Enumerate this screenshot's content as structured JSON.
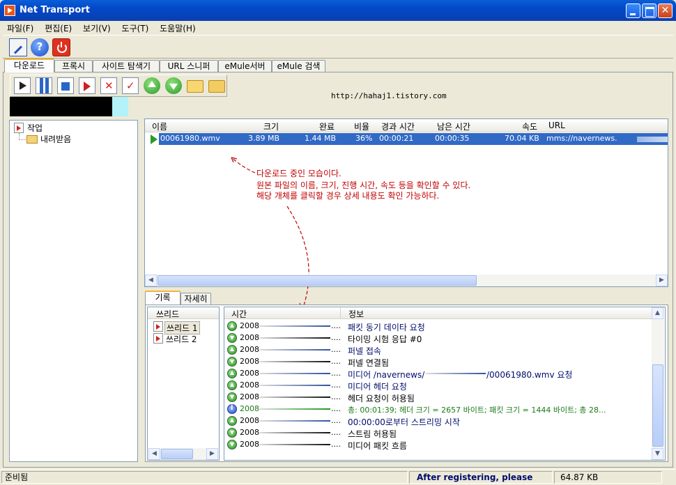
{
  "window": {
    "title": "Net Transport"
  },
  "menu": [
    "파일(F)",
    "편집(E)",
    "보기(V)",
    "도구(T)",
    "도움말(H)"
  ],
  "toolbar_icons": [
    "edit-icon",
    "help-icon",
    "power-icon"
  ],
  "tabs": [
    "다운로드",
    "프록시",
    "사이트 탐색기",
    "URL 스니퍼",
    "eMule서버",
    "eMule 검색"
  ],
  "active_tab": "다운로드",
  "download_toolbar_icons": [
    "start-icon",
    "pause-icon",
    "stop-icon",
    "move-icon",
    "delete-icon",
    "check-icon",
    "move-up-icon",
    "move-down-icon",
    "open-folder-icon",
    "folder-icon"
  ],
  "watermark_url": "http://hahaj1.tistory.com",
  "tree": {
    "root": "작업",
    "child": "내려받음"
  },
  "download_list": {
    "columns": [
      "이름",
      "크기",
      "완료",
      "비율",
      "경과 시간",
      "남은 시간",
      "속도",
      "URL"
    ],
    "rows": [
      {
        "name": "00061980.wmv",
        "size": "3.89 MB",
        "done": "1.44 MB",
        "ratio": "36%",
        "elapsed": "00:00:21",
        "remaining": "00:00:35",
        "speed": "70.04 KB",
        "url": "mms://navernews."
      }
    ]
  },
  "annotation": {
    "line1": "다운로드 중인 모습이다.",
    "line2": "원본 파일의 이름, 크기, 진행 시간, 속도 등을 확인할 수 있다.",
    "line3": "해당 개체를 클릭할 경우 상세 내용도 확인 가능하다.",
    "color": "#c00000"
  },
  "log_tabs": [
    "기록",
    "자세히"
  ],
  "threads": {
    "header": "쓰리드",
    "items": [
      "쓰리드 1",
      "쓰리드 2"
    ]
  },
  "log": {
    "columns": [
      "시간",
      "정보"
    ],
    "rows": [
      {
        "icon": "up",
        "time": "2008-",
        "info": "패킷 동기 데이타 요청"
      },
      {
        "icon": "down",
        "time": "2008-",
        "info": "타이밍 시험 응답 #0"
      },
      {
        "icon": "up",
        "time": "2008-",
        "info": "퍼넬 접속"
      },
      {
        "icon": "down",
        "time": "2008-",
        "info": "퍼넬 연결됨"
      },
      {
        "icon": "up",
        "time": "2008-",
        "info": "미디어 /navernews/",
        "info_tail": "/00061980.wmv 요청"
      },
      {
        "icon": "up",
        "time": "2008-",
        "info": "미디어 헤더 요청"
      },
      {
        "icon": "down",
        "time": "2008-",
        "info": "헤더 요청이 허용됨"
      },
      {
        "icon": "info",
        "time": "2008-",
        "info": "총: 00:01:39; 헤더 크기 = 2657 바이트; 패킷 크기 = 1444 바이트; 총 28..."
      },
      {
        "icon": "up",
        "time": "2008-",
        "info": "00:00:00로부터 스트리밍 시작"
      },
      {
        "icon": "down",
        "time": "2008-",
        "info": "스트림 허용됨"
      },
      {
        "icon": "down",
        "time": "2008-",
        "info": "미디어 패킷 흐름"
      }
    ],
    "dots": "...."
  },
  "status": {
    "left": "준비됨",
    "middle": "After registering, please",
    "right": "64.87 KB"
  }
}
